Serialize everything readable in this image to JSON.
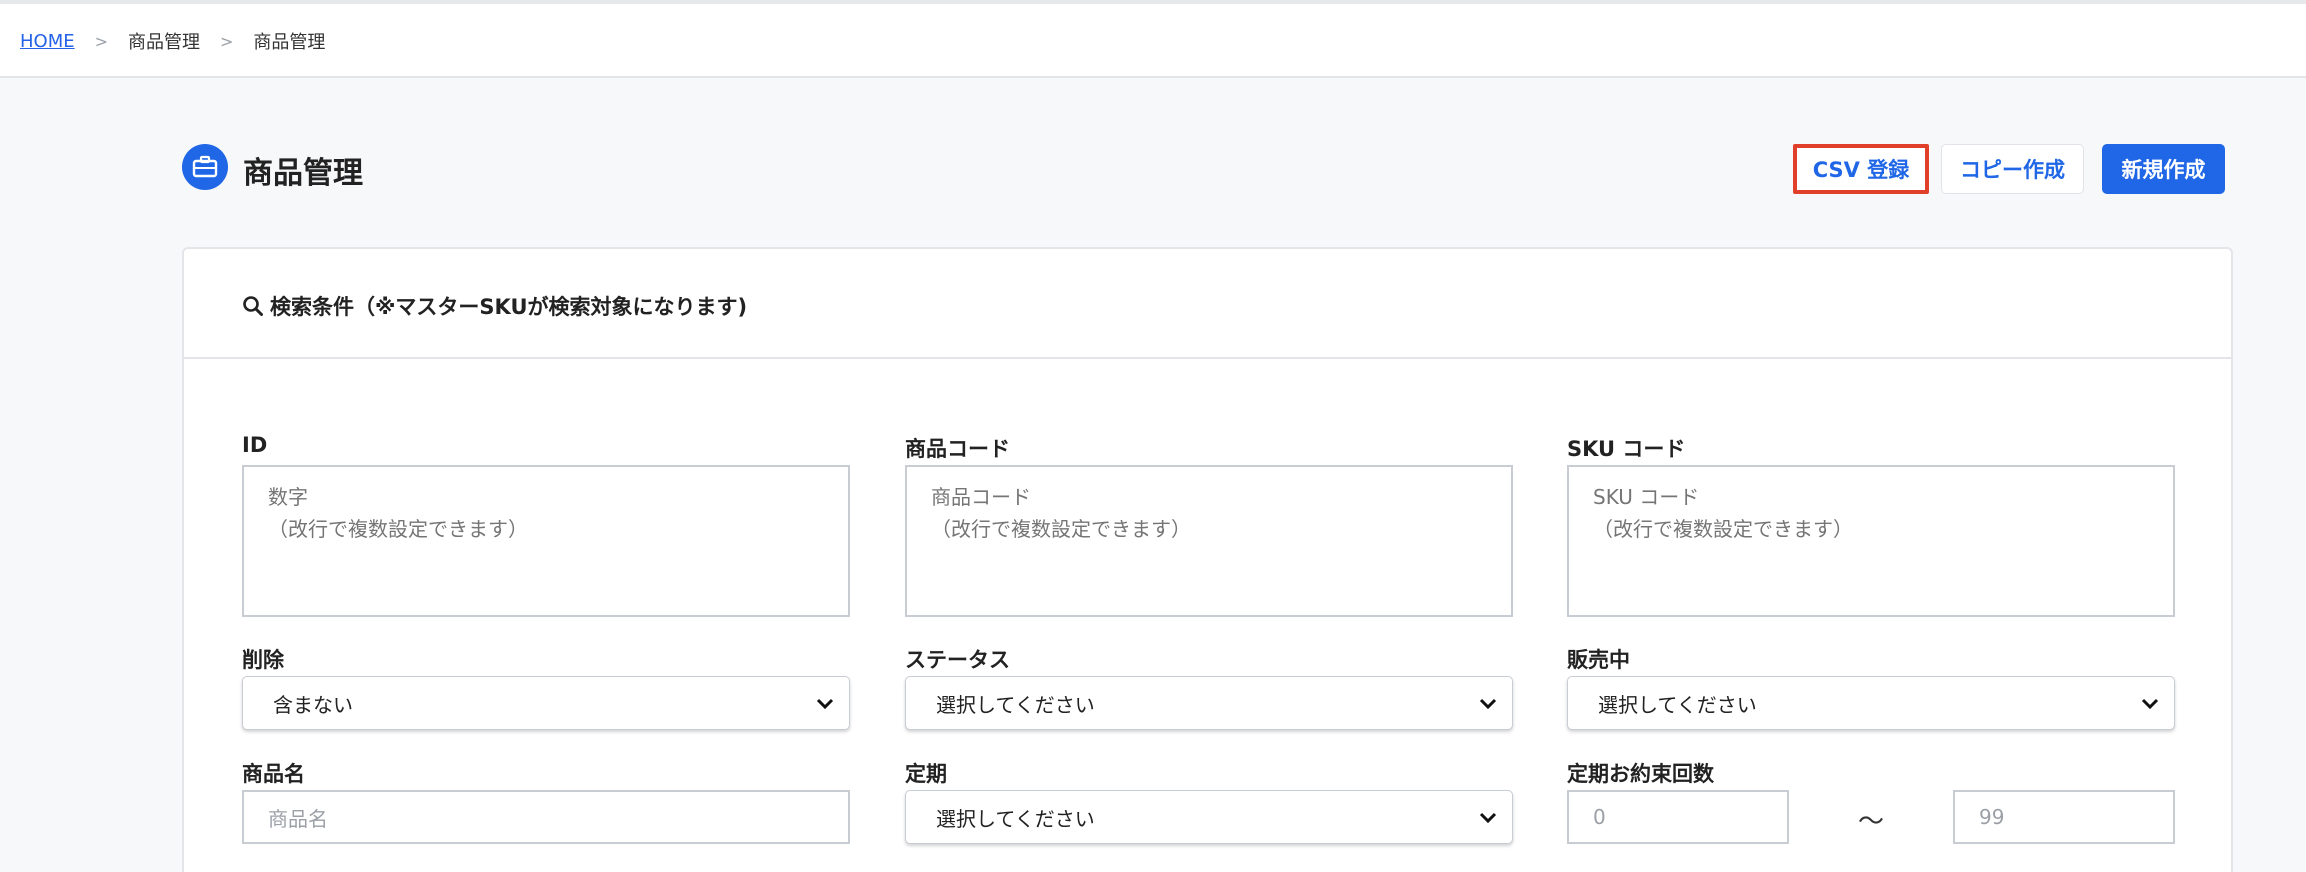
{
  "breadcrumb": {
    "home": "HOME",
    "level1": "商品管理",
    "level2": "商品管理",
    "separator": ">"
  },
  "page": {
    "title": "商品管理"
  },
  "actions": {
    "csv": "CSV 登録",
    "copy": "コピー作成",
    "new": "新規作成"
  },
  "search": {
    "title": "検索条件（※マスターSKUが検索対象になります)",
    "id": {
      "label": "ID",
      "placeholder": "数字\n（改行で複数設定できます）"
    },
    "product_code": {
      "label": "商品コード",
      "placeholder": "商品コード\n（改行で複数設定できます）"
    },
    "sku_code": {
      "label": "SKU コード",
      "placeholder": "SKU コード\n（改行で複数設定できます）"
    },
    "deleted": {
      "label": "削除",
      "value": "含まない"
    },
    "status": {
      "label": "ステータス",
      "value": "選択してください"
    },
    "on_sale": {
      "label": "販売中",
      "value": "選択してください"
    },
    "product_name": {
      "label": "商品名",
      "placeholder": "商品名"
    },
    "subscription": {
      "label": "定期",
      "value": "選択してください"
    },
    "promise_count": {
      "label": "定期お約束回数",
      "min_placeholder": "0",
      "max_placeholder": "99",
      "range_sep": "〜"
    }
  },
  "colors": {
    "accent": "#1f67e6",
    "highlight": "#e0402a"
  }
}
